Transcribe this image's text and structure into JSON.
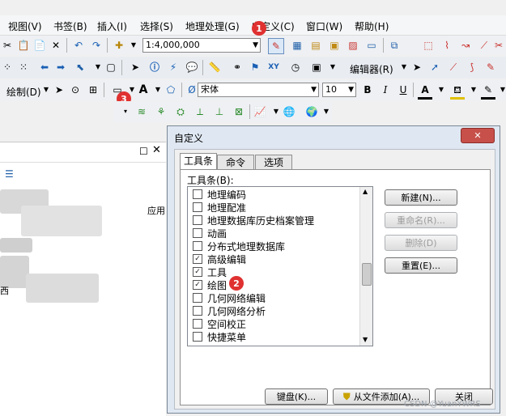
{
  "menubar": {
    "items": [
      "视图(V)",
      "书签(B)",
      "插入(I)",
      "选择(S)",
      "地理处理(G)",
      "自定义(C)",
      "窗口(W)",
      "帮助(H)"
    ]
  },
  "toolbar1": {
    "scale": "1:4,000,000"
  },
  "toolbar2": {
    "editor_label": "编辑器(R)"
  },
  "toolbar3": {
    "draw_label": "绘制(D)",
    "text_glyph": "A",
    "font": "宋体",
    "size": "10",
    "bold": "B",
    "italic": "I",
    "underline": "U"
  },
  "badges": {
    "b1": "1",
    "b2": "2",
    "b3": "3"
  },
  "leftpanel": {
    "side_text": "应用",
    "char1": "西"
  },
  "dialog": {
    "title": "自定义",
    "close_glyph": "✕",
    "tabs": [
      "工具条",
      "命令",
      "选项"
    ],
    "list_label": "工具条(B):",
    "toolbars": [
      {
        "label": "地理编码",
        "checked": false
      },
      {
        "label": "地理配准",
        "checked": false
      },
      {
        "label": "地理数据库历史档案管理",
        "checked": false
      },
      {
        "label": "动画",
        "checked": false
      },
      {
        "label": "分布式地理数据库",
        "checked": false
      },
      {
        "label": "高级编辑",
        "checked": true
      },
      {
        "label": "工具",
        "checked": true
      },
      {
        "label": "绘图",
        "checked": true
      },
      {
        "label": "几何网络编辑",
        "checked": false
      },
      {
        "label": "几何网络分析",
        "checked": false
      },
      {
        "label": "空间校正",
        "checked": false
      },
      {
        "label": "快捷菜单",
        "checked": false
      }
    ],
    "buttons": {
      "new": "新建(N)...",
      "rename": "重命名(R)...",
      "delete": "删除(D)",
      "reset": "重置(E)..."
    },
    "footer": {
      "keyboard": "键盘(K)...",
      "add_from_file": "从文件添加(A)...",
      "close": "关闭"
    }
  },
  "watermark": "CSDN @YuanYWRS"
}
